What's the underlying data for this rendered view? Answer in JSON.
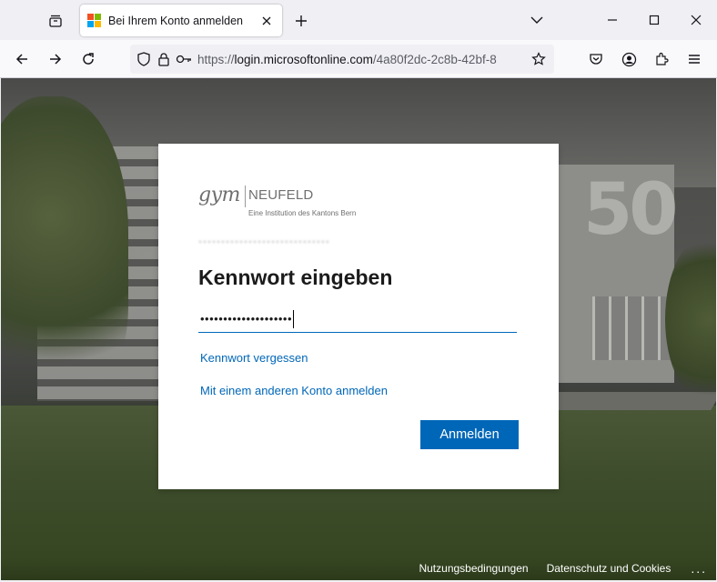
{
  "browser": {
    "tab": {
      "title": "Bei Ihrem Konto anmelden",
      "favicon": "microsoft-logo",
      "favicon_colors": [
        "#f25022",
        "#7fba00",
        "#00a4ef",
        "#ffb900"
      ]
    },
    "url": {
      "scheme": "https://",
      "host": "login.microsoftonline.com",
      "path": "/4a80f2dc-2c8b-42bf-8"
    },
    "icons": [
      "tab-list-icon",
      "close-tab-icon",
      "new-tab-icon",
      "list-all-tabs-icon",
      "minimize-icon",
      "maximize-icon",
      "close-window-icon",
      "back-icon",
      "forward-icon",
      "reload-icon",
      "shield-icon",
      "lock-icon",
      "key-icon",
      "bookmark-star-icon",
      "pocket-icon",
      "account-icon",
      "extensions-icon",
      "menu-icon"
    ]
  },
  "login": {
    "logo": {
      "gym": "gym",
      "neufeld": "NEUFELD",
      "subtitle": "Eine Institution des Kantons Bern"
    },
    "account_masked": "·····························",
    "heading": "Kennwort eingeben",
    "password_value": "••••••••••••••••••••",
    "forgot_link": "Kennwort vergessen",
    "other_account_link": "Mit einem anderen Konto anmelden",
    "signin_button": "Anmelden"
  },
  "footer": {
    "terms": "Nutzungsbedingungen",
    "privacy": "Datenschutz und Cookies",
    "more": "..."
  },
  "colors": {
    "accent": "#0067b8",
    "card_bg": "#ffffff",
    "chrome_bg": "#f0f0f4"
  }
}
